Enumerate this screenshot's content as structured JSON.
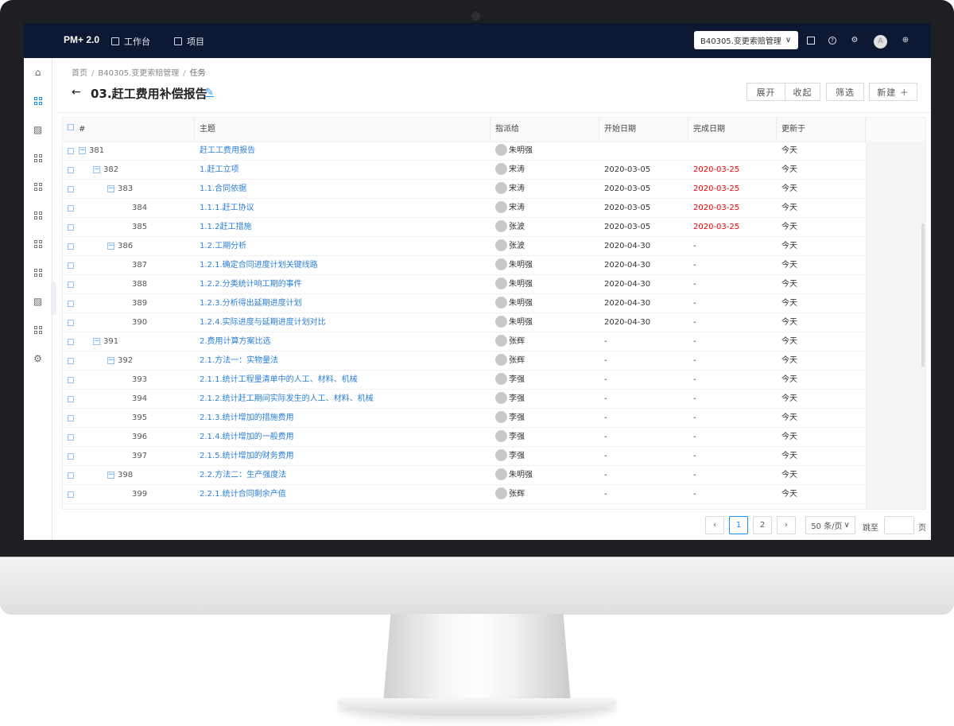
{
  "app": {
    "brand": "PM+ 2.0",
    "nav": [
      {
        "label": "工作台"
      },
      {
        "label": "项目"
      }
    ],
    "project_select": "B40305.变更索赔管理",
    "avatar_initial": "A"
  },
  "breadcrumb": [
    "首页",
    "B40305.变更索赔管理",
    "任务"
  ],
  "page": {
    "title": "03.赶工费用补偿报告"
  },
  "buttons": {
    "expand": "展开",
    "collapse": "收起",
    "filter": "筛选",
    "create": "新建 ＋"
  },
  "table": {
    "columns": [
      "#",
      "主题",
      "指派给",
      "开始日期",
      "完成日期",
      "更新于"
    ],
    "rows": [
      {
        "id": "381",
        "level": 0,
        "toggle": true,
        "subject": "赶工工费用报告",
        "assignee": "朱明强",
        "start": "",
        "end": "",
        "end_overdue": false,
        "updated": "今天"
      },
      {
        "id": "382",
        "level": 1,
        "toggle": true,
        "subject": "1.赶工立项",
        "assignee": "宋涛",
        "start": "2020-03-05",
        "end": "2020-03-25",
        "end_overdue": true,
        "updated": "今天"
      },
      {
        "id": "383",
        "level": 2,
        "toggle": true,
        "subject": "1.1.合同依据",
        "assignee": "宋涛",
        "start": "2020-03-05",
        "end": "2020-03-25",
        "end_overdue": true,
        "updated": "今天"
      },
      {
        "id": "384",
        "level": 3,
        "toggle": false,
        "subject": "1.1.1.赶工协议",
        "assignee": "宋涛",
        "start": "2020-03-05",
        "end": "2020-03-25",
        "end_overdue": true,
        "updated": "今天"
      },
      {
        "id": "385",
        "level": 3,
        "toggle": false,
        "subject": "1.1.2赶工措施",
        "assignee": "张波",
        "start": "2020-03-05",
        "end": "2020-03-25",
        "end_overdue": true,
        "updated": "今天"
      },
      {
        "id": "386",
        "level": 2,
        "toggle": true,
        "subject": "1.2.工期分析",
        "assignee": "张波",
        "start": "2020-04-30",
        "end": "-",
        "end_overdue": false,
        "updated": "今天"
      },
      {
        "id": "387",
        "level": 3,
        "toggle": false,
        "subject": "1.2.1.确定合同进度计划关键线路",
        "assignee": "朱明强",
        "start": "2020-04-30",
        "end": "-",
        "end_overdue": false,
        "updated": "今天"
      },
      {
        "id": "388",
        "level": 3,
        "toggle": false,
        "subject": "1.2.2.分类统计响工期的事件",
        "assignee": "朱明强",
        "start": "2020-04-30",
        "end": "-",
        "end_overdue": false,
        "updated": "今天"
      },
      {
        "id": "389",
        "level": 3,
        "toggle": false,
        "subject": "1.2.3.分析得出延期进度计划",
        "assignee": "朱明强",
        "start": "2020-04-30",
        "end": "-",
        "end_overdue": false,
        "updated": "今天"
      },
      {
        "id": "390",
        "level": 3,
        "toggle": false,
        "subject": "1.2.4.实际进度与延期进度计划对比",
        "assignee": "朱明强",
        "start": "2020-04-30",
        "end": "-",
        "end_overdue": false,
        "updated": "今天"
      },
      {
        "id": "391",
        "level": 1,
        "toggle": true,
        "subject": "2.费用计算方案比选",
        "assignee": "张辉",
        "start": "-",
        "end": "-",
        "end_overdue": false,
        "updated": "今天"
      },
      {
        "id": "392",
        "level": 2,
        "toggle": true,
        "subject": "2.1.方法一：实物量法",
        "assignee": "张辉",
        "start": "-",
        "end": "-",
        "end_overdue": false,
        "updated": "今天"
      },
      {
        "id": "393",
        "level": 3,
        "toggle": false,
        "subject": "2.1.1.统计工程量清单中的人工、材料、机械",
        "assignee": "李强",
        "start": "-",
        "end": "-",
        "end_overdue": false,
        "updated": "今天"
      },
      {
        "id": "394",
        "level": 3,
        "toggle": false,
        "subject": "2.1.2.统计赶工期间实际发生的人工、材料、机械",
        "assignee": "李强",
        "start": "-",
        "end": "-",
        "end_overdue": false,
        "updated": "今天"
      },
      {
        "id": "395",
        "level": 3,
        "toggle": false,
        "subject": "2.1.3.统计增加的措施费用",
        "assignee": "李强",
        "start": "-",
        "end": "-",
        "end_overdue": false,
        "updated": "今天"
      },
      {
        "id": "396",
        "level": 3,
        "toggle": false,
        "subject": "2.1.4.统计增加的一般费用",
        "assignee": "李强",
        "start": "-",
        "end": "-",
        "end_overdue": false,
        "updated": "今天"
      },
      {
        "id": "397",
        "level": 3,
        "toggle": false,
        "subject": "2.1.5.统计增加的财务费用",
        "assignee": "李强",
        "start": "-",
        "end": "-",
        "end_overdue": false,
        "updated": "今天"
      },
      {
        "id": "398",
        "level": 2,
        "toggle": true,
        "subject": "2.2.方法二：生产强度法",
        "assignee": "朱明强",
        "start": "-",
        "end": "-",
        "end_overdue": false,
        "updated": "今天"
      },
      {
        "id": "399",
        "level": 3,
        "toggle": false,
        "subject": "2.2.1.统计合同剩余产值",
        "assignee": "张辉",
        "start": "-",
        "end": "-",
        "end_overdue": false,
        "updated": "今天"
      }
    ]
  },
  "pagination": {
    "prev": "‹",
    "pages": [
      "1",
      "2"
    ],
    "current": "1",
    "next": "›",
    "page_size": "50 条/页",
    "jump_label": "跳至",
    "page_unit": "页"
  },
  "icons": {
    "sidebar": [
      "home-icon",
      "grid-icon",
      "image-icon",
      "grid-icon",
      "grid-icon",
      "grid-icon",
      "grid-icon",
      "grid-icon",
      "image-icon",
      "grid-icon",
      "settings-icon"
    ],
    "top_right": [
      "qrcode-icon",
      "help-icon",
      "settings-icon",
      "user-avatar",
      "globe-icon"
    ]
  },
  "colors": {
    "topbar": "#0d1933",
    "accent": "#1890ff",
    "overdue": "#e00000"
  }
}
